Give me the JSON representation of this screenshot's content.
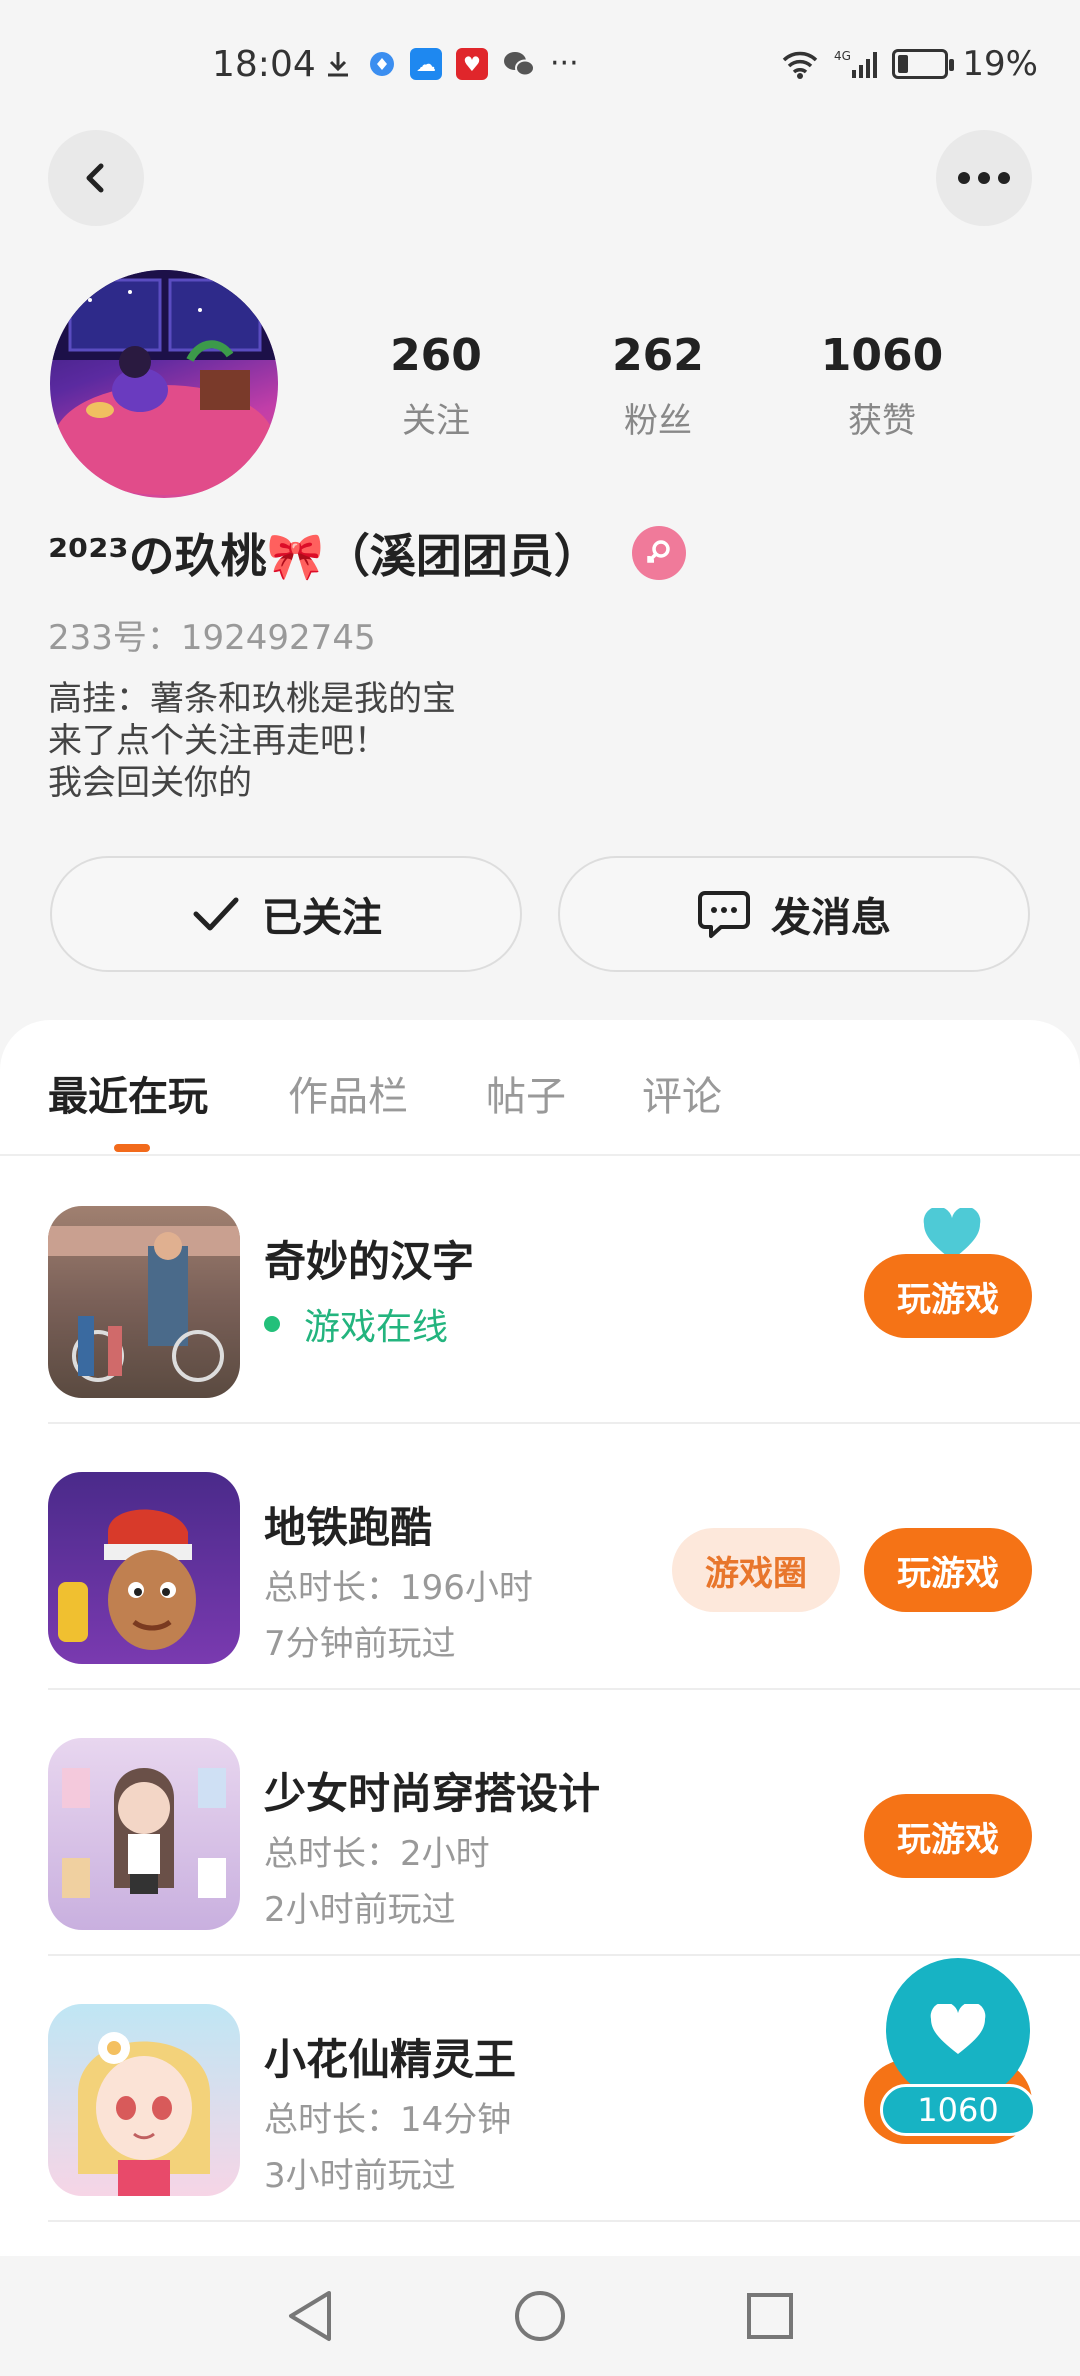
{
  "status_bar": {
    "time": "18:04",
    "battery": "19%",
    "battery_level": 0.19,
    "icons": [
      "download-icon",
      "app-icon",
      "weather-icon",
      "app-icon",
      "wechat-icon",
      "more-dots"
    ],
    "network": "4G"
  },
  "profile": {
    "nickname": "²⁰²³の玖桃🎀（溪团团员）",
    "gender": "female",
    "uid": "233号：192492745",
    "bio": [
      "高挂：薯条和玖桃是我的宝",
      "来了点个关注再走吧！",
      "我会回关你的"
    ],
    "stats": [
      {
        "value": "260",
        "label": "关注"
      },
      {
        "value": "262",
        "label": "粉丝"
      },
      {
        "value": "1060",
        "label": "获赞"
      }
    ],
    "follow_label": "已关注",
    "message_label": "发消息"
  },
  "tabs": [
    {
      "label": "最近在玩",
      "active": true
    },
    {
      "label": "作品栏",
      "active": false
    },
    {
      "label": "帖子",
      "active": false
    },
    {
      "label": "评论",
      "active": false
    }
  ],
  "games": [
    {
      "title": "奇妙的汉字",
      "status": "游戏在线",
      "play_label": "玩游戏"
    },
    {
      "title": "地铁跑酷",
      "duration": "总时长：196小时",
      "last_played": "7分钟前玩过",
      "circle_label": "游戏圈",
      "play_label": "玩游戏"
    },
    {
      "title": "少女时尚穿搭设计",
      "duration": "总时长：2小时",
      "last_played": "2小时前玩过",
      "play_label": "玩游戏"
    },
    {
      "title": "小花仙精灵王",
      "duration": "总时长：14分钟",
      "last_played": "3小时前玩过",
      "play_label": "玩游戏"
    }
  ],
  "float_like": {
    "count": "1060"
  },
  "colors": {
    "accent": "#f57316",
    "teal": "#17b3c4",
    "online": "#23b47e"
  }
}
